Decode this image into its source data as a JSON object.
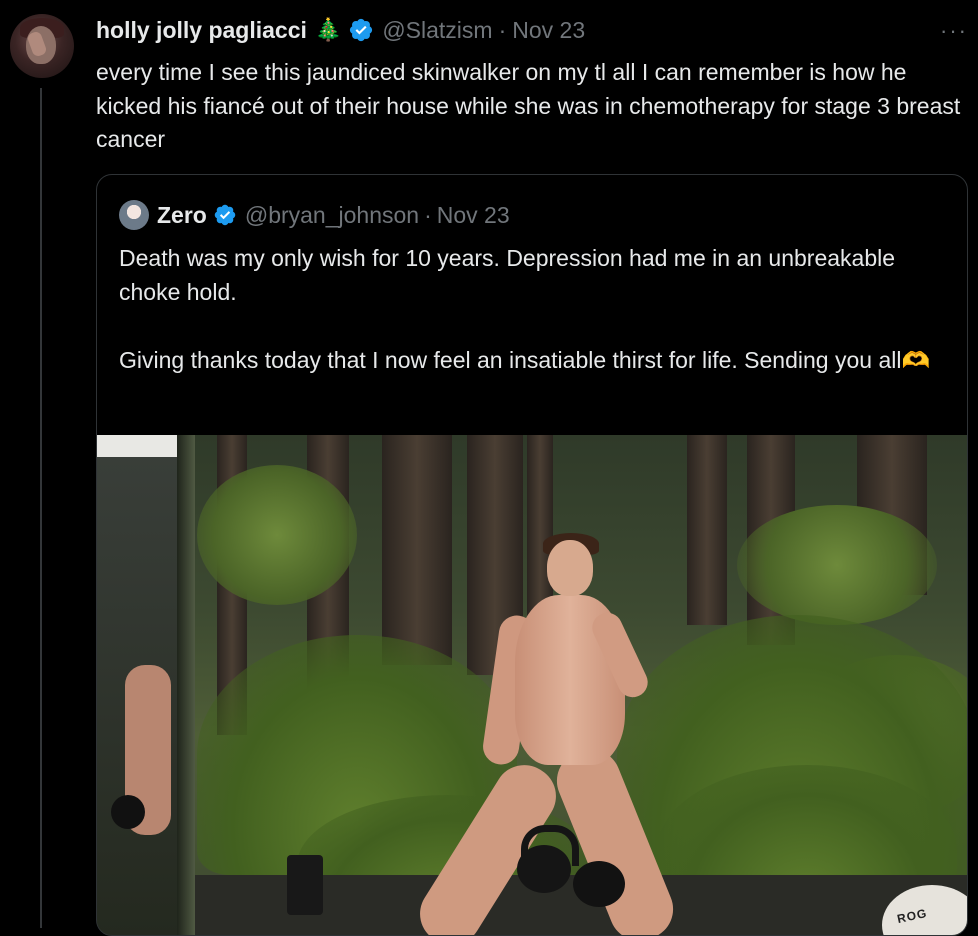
{
  "tweet": {
    "author_name": "holly jolly pagliacci",
    "name_emoji": "🎄",
    "handle": "@Slatzism",
    "separator": "·",
    "date": "Nov 23",
    "more_label": "···",
    "text": "every time I see this jaundiced skinwalker on my tl all I can remember is how he kicked his fiancé out of their house while she was in chemotherapy for stage 3 breast cancer"
  },
  "quote": {
    "author_name": "Zero",
    "handle": "@bryan_johnson",
    "separator": "·",
    "date": "Nov 23",
    "text": "Death was my only wish for 10 years. Depression had me in an unbreakable choke hold.\n\nGiving thanks today that I now feel an insatiable thirst for life. Sending you all🫶",
    "media_caption_visible": "ROG"
  },
  "colors": {
    "background": "#000000",
    "text_primary": "#e7e9ea",
    "text_secondary": "#71767b",
    "verified": "#1d9bf0",
    "border": "#2f3336"
  },
  "icons": {
    "verified": "verified-badge-icon",
    "more": "more-options-icon"
  }
}
